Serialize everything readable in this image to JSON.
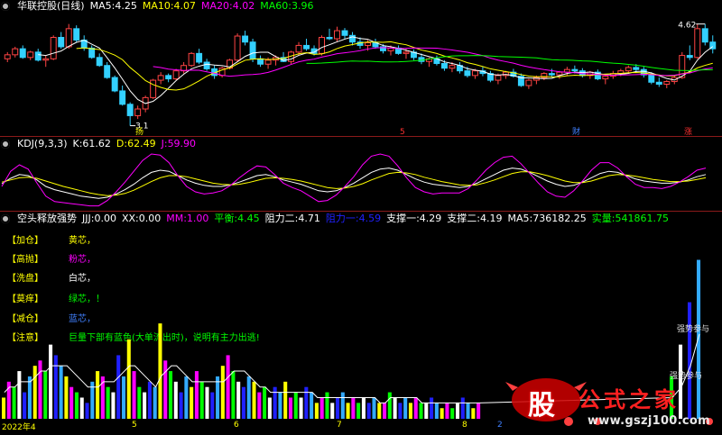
{
  "main_panel": {
    "title": "华联控股(日线)",
    "indicators": [
      {
        "label": "MA5:",
        "value": "4.25",
        "color": "#ffffff"
      },
      {
        "label": "MA10:",
        "value": "4.07",
        "color": "#ffff00"
      },
      {
        "label": "MA20:",
        "value": "4.02",
        "color": "#ff00ff"
      },
      {
        "label": "MA60:",
        "value": "3.96",
        "color": "#00ff00"
      }
    ],
    "high_mark": "4.62",
    "low_mark": "3.1",
    "event_tags": [
      "扬",
      "5",
      "财",
      "涨"
    ]
  },
  "kdj_panel": {
    "title": "KDJ(9,3,3)",
    "indicators": [
      {
        "label": "K:",
        "value": "61.62",
        "color": "#ffffff"
      },
      {
        "label": "D:",
        "value": "62.49",
        "color": "#ffff00"
      },
      {
        "label": "J:",
        "value": "59.90",
        "color": "#ff00ff"
      }
    ]
  },
  "volume_panel": {
    "title": "空头释放强势",
    "indicators": [
      {
        "label": "JJJ:",
        "value": "0.00",
        "color": "#ffffff"
      },
      {
        "label": "XX:",
        "value": "0.00",
        "color": "#ffffff"
      },
      {
        "label": "MM:",
        "value": "1.00",
        "color": "#ff00ff"
      },
      {
        "label": "平衡:",
        "value": "4.45",
        "color": "#00ff00"
      },
      {
        "label": "阻力二:",
        "value": "4.71",
        "color": "#ffffff"
      },
      {
        "label": "阻力一:",
        "value": "4.59",
        "color": "#0000ff"
      },
      {
        "label": "支撑一:",
        "value": "4.29",
        "color": "#ffffff"
      },
      {
        "label": "支撑二:",
        "value": "4.19",
        "color": "#ffffff"
      },
      {
        "label": "MA5:",
        "value": "736182.25",
        "color": "#ffffff"
      },
      {
        "label": "实量:",
        "value": "541861.75",
        "color": "#00ff00"
      }
    ],
    "legend": [
      {
        "key": "【加仓】",
        "text": "黄芯，",
        "color": "#ffff00"
      },
      {
        "key": "【高抛】",
        "text": "粉芯，",
        "color": "#ff00ff"
      },
      {
        "key": "【洗盘】",
        "text": "白芯，",
        "color": "#ffffff"
      },
      {
        "key": "【莫痒】",
        "text": "绿芯，！",
        "color": "#00ff00"
      },
      {
        "key": "【减仓】",
        "text": "蓝芯，",
        "color": "#4080ff"
      },
      {
        "key": "【注意】",
        "text": "巨量下部有蓝色(大单流出时)，说明有主力出逃!",
        "color": "#00ff00"
      }
    ],
    "side_labels": [
      "强势参与",
      "强势参与"
    ]
  },
  "x_axis": {
    "labels": [
      {
        "text": "2022年4",
        "color": "#ffff00"
      },
      {
        "text": "5",
        "color": "#ffff00"
      },
      {
        "text": "6",
        "color": "#ffff00"
      },
      {
        "text": "7",
        "color": "#ffff00"
      },
      {
        "text": "8",
        "color": "#ffff00"
      },
      {
        "text": "2",
        "color": "#4080ff"
      }
    ]
  },
  "watermark": {
    "logo_char": "股",
    "brand": "公式之家",
    "url": "www.gszj100.com"
  },
  "chart_data": [
    {
      "type": "candlestick",
      "title": "华联控股(日线)",
      "ylim": [
        3.0,
        4.75
      ],
      "candles": [
        [
          4.1,
          4.2,
          4.05,
          4.16
        ],
        [
          4.16,
          4.28,
          4.12,
          4.25
        ],
        [
          4.25,
          4.3,
          4.1,
          4.12
        ],
        [
          4.12,
          4.22,
          4.08,
          4.2
        ],
        [
          4.2,
          4.25,
          4.06,
          4.08
        ],
        [
          4.08,
          4.15,
          3.98,
          4.1
        ],
        [
          4.1,
          4.45,
          4.08,
          4.42
        ],
        [
          4.42,
          4.5,
          4.25,
          4.28
        ],
        [
          4.28,
          4.62,
          4.25,
          4.55
        ],
        [
          4.55,
          4.6,
          4.35,
          4.38
        ],
        [
          4.38,
          4.45,
          4.22,
          4.26
        ],
        [
          4.26,
          4.3,
          4.1,
          4.12
        ],
        [
          4.12,
          4.18,
          3.98,
          4.0
        ],
        [
          4.0,
          4.05,
          3.8,
          3.82
        ],
        [
          3.82,
          3.85,
          3.6,
          3.62
        ],
        [
          3.62,
          3.7,
          3.4,
          3.42
        ],
        [
          3.42,
          3.45,
          3.1,
          3.25
        ],
        [
          3.25,
          3.4,
          3.2,
          3.35
        ],
        [
          3.35,
          3.55,
          3.3,
          3.52
        ],
        [
          3.52,
          3.8,
          3.5,
          3.78
        ],
        [
          3.78,
          3.9,
          3.72,
          3.85
        ],
        [
          3.85,
          3.88,
          3.75,
          3.8
        ],
        [
          3.8,
          3.95,
          3.78,
          3.92
        ],
        [
          3.92,
          4.05,
          3.88,
          4.0
        ],
        [
          4.0,
          4.2,
          3.98,
          4.18
        ],
        [
          4.18,
          4.25,
          4.02,
          4.05
        ],
        [
          4.05,
          4.1,
          3.92,
          3.95
        ],
        [
          3.95,
          4.0,
          3.8,
          3.85
        ],
        [
          3.85,
          3.98,
          3.82,
          3.96
        ],
        [
          3.96,
          4.1,
          3.94,
          4.08
        ],
        [
          4.08,
          4.48,
          4.05,
          4.44
        ],
        [
          4.44,
          4.52,
          4.3,
          4.35
        ],
        [
          4.35,
          4.4,
          4.05,
          4.1
        ],
        [
          4.1,
          4.15,
          3.98,
          4.02
        ],
        [
          4.02,
          4.12,
          3.95,
          4.08
        ],
        [
          4.08,
          4.15,
          4.0,
          4.12
        ],
        [
          4.12,
          4.2,
          4.05,
          4.06
        ],
        [
          4.06,
          4.22,
          4.02,
          4.2
        ],
        [
          4.2,
          4.35,
          4.15,
          4.3
        ],
        [
          4.3,
          4.4,
          4.22,
          4.25
        ],
        [
          4.25,
          4.3,
          4.15,
          4.18
        ],
        [
          4.18,
          4.45,
          4.15,
          4.42
        ],
        [
          4.42,
          4.55,
          4.38,
          4.4
        ],
        [
          4.4,
          4.58,
          4.35,
          4.52
        ],
        [
          4.52,
          4.56,
          4.4,
          4.45
        ],
        [
          4.45,
          4.5,
          4.3,
          4.35
        ],
        [
          4.35,
          4.42,
          4.25,
          4.3
        ],
        [
          4.3,
          4.38,
          4.22,
          4.34
        ],
        [
          4.34,
          4.4,
          4.25,
          4.28
        ],
        [
          4.28,
          4.32,
          4.18,
          4.22
        ],
        [
          4.22,
          4.3,
          4.15,
          4.26
        ],
        [
          4.26,
          4.3,
          4.16,
          4.18
        ],
        [
          4.18,
          4.25,
          4.1,
          4.2
        ],
        [
          4.2,
          4.24,
          4.08,
          4.12
        ],
        [
          4.12,
          4.18,
          4.02,
          4.06
        ],
        [
          4.06,
          4.12,
          3.98,
          4.1
        ],
        [
          4.1,
          4.15,
          4.0,
          4.03
        ],
        [
          4.03,
          4.08,
          3.92,
          3.96
        ],
        [
          3.96,
          4.05,
          3.9,
          4.0
        ],
        [
          4.0,
          4.05,
          3.88,
          3.92
        ],
        [
          3.92,
          3.98,
          3.82,
          3.85
        ],
        [
          3.85,
          3.95,
          3.8,
          3.92
        ],
        [
          3.92,
          3.98,
          3.84,
          3.88
        ],
        [
          3.88,
          3.92,
          3.75,
          3.78
        ],
        [
          3.78,
          3.88,
          3.72,
          3.85
        ],
        [
          3.85,
          3.92,
          3.8,
          3.9
        ],
        [
          3.9,
          3.95,
          3.82,
          3.84
        ],
        [
          3.84,
          3.88,
          3.68,
          3.7
        ],
        [
          3.7,
          3.8,
          3.65,
          3.78
        ],
        [
          3.78,
          3.85,
          3.72,
          3.82
        ],
        [
          3.82,
          3.9,
          3.78,
          3.88
        ],
        [
          3.88,
          3.95,
          3.82,
          3.86
        ],
        [
          3.86,
          3.92,
          3.8,
          3.9
        ],
        [
          3.9,
          3.98,
          3.85,
          3.94
        ],
        [
          3.94,
          4.0,
          3.88,
          3.92
        ],
        [
          3.92,
          3.96,
          3.82,
          3.85
        ],
        [
          3.85,
          3.92,
          3.8,
          3.9
        ],
        [
          3.9,
          3.94,
          3.78,
          3.8
        ],
        [
          3.8,
          3.86,
          3.72,
          3.84
        ],
        [
          3.84,
          3.92,
          3.8,
          3.88
        ],
        [
          3.88,
          3.95,
          3.84,
          3.92
        ],
        [
          3.92,
          4.0,
          3.88,
          3.97
        ],
        [
          3.97,
          4.02,
          3.9,
          3.94
        ],
        [
          3.94,
          3.98,
          3.82,
          3.86
        ],
        [
          3.86,
          3.9,
          3.72,
          3.75
        ],
        [
          3.75,
          3.82,
          3.68,
          3.72
        ],
        [
          3.72,
          3.78,
          3.66,
          3.76
        ],
        [
          3.76,
          3.85,
          3.72,
          3.82
        ],
        [
          3.82,
          4.2,
          3.8,
          4.15
        ],
        [
          4.15,
          4.3,
          4.08,
          4.12
        ],
        [
          4.12,
          4.62,
          4.1,
          4.55
        ],
        [
          4.55,
          4.62,
          4.3,
          4.35
        ],
        [
          4.35,
          4.45,
          4.18,
          4.25
        ]
      ]
    },
    {
      "type": "line",
      "title": "KDJ(9,3,3)",
      "ylim": [
        0,
        100
      ],
      "series": [
        {
          "name": "K",
          "values": [
            45,
            55,
            62,
            60,
            52,
            40,
            34,
            30,
            26,
            22,
            20,
            18,
            20,
            26,
            34,
            44,
            56,
            66,
            70,
            68,
            60,
            52,
            46,
            42,
            40,
            40,
            43,
            48,
            54,
            60,
            62,
            58,
            52,
            48,
            44,
            38,
            32,
            30,
            32,
            38,
            46,
            56,
            66,
            72,
            74,
            70,
            62,
            54,
            48,
            44,
            42,
            40,
            38,
            40,
            46,
            54,
            62,
            70,
            74,
            72,
            66,
            58,
            50,
            44,
            40,
            42,
            48,
            56,
            64,
            68,
            66,
            60,
            54,
            50,
            48,
            46,
            46,
            48,
            52,
            58,
            62
          ]
        },
        {
          "name": "D",
          "values": [
            48,
            52,
            56,
            57,
            55,
            50,
            45,
            40,
            36,
            32,
            28,
            25,
            23,
            24,
            27,
            33,
            41,
            49,
            56,
            60,
            60,
            58,
            54,
            50,
            46,
            44,
            43,
            44,
            47,
            51,
            55,
            56,
            55,
            53,
            50,
            46,
            42,
            38,
            36,
            37,
            40,
            45,
            52,
            58,
            64,
            66,
            65,
            62,
            57,
            53,
            49,
            46,
            43,
            42,
            43,
            47,
            52,
            58,
            64,
            67,
            67,
            64,
            60,
            55,
            50,
            47,
            47,
            50,
            55,
            60,
            62,
            61,
            59,
            56,
            53,
            51,
            49,
            49,
            50,
            53,
            56
          ]
        },
        {
          "name": "J",
          "values": [
            40,
            68,
            80,
            72,
            46,
            22,
            12,
            10,
            8,
            6,
            4,
            4,
            14,
            30,
            48,
            68,
            88,
            100,
            98,
            84,
            60,
            40,
            30,
            26,
            28,
            32,
            42,
            56,
            68,
            78,
            76,
            62,
            46,
            38,
            32,
            22,
            12,
            14,
            24,
            40,
            58,
            80,
            96,
            100,
            96,
            78,
            56,
            38,
            30,
            26,
            28,
            28,
            28,
            36,
            52,
            70,
            84,
            94,
            96,
            82,
            64,
            46,
            30,
            22,
            20,
            32,
            50,
            70,
            84,
            84,
            74,
            58,
            44,
            38,
            38,
            36,
            40,
            48,
            58,
            70,
            74
          ]
        }
      ]
    },
    {
      "type": "bar",
      "title": "空头释放强势",
      "series": [
        {
          "name": "实量",
          "values": [
            4,
            7,
            6,
            9,
            5,
            8,
            10,
            11,
            9,
            14,
            12,
            10,
            8,
            6,
            5,
            4,
            3,
            7,
            9,
            8,
            6,
            5,
            12,
            8,
            15,
            9,
            6,
            5,
            7,
            6,
            18,
            11,
            9,
            7,
            5,
            8,
            6,
            9,
            7,
            6,
            5,
            8,
            10,
            12,
            9,
            7,
            6,
            8,
            7,
            5,
            6,
            4,
            6,
            5,
            7,
            4,
            5,
            4,
            6,
            5,
            3,
            4,
            5,
            3,
            4,
            5,
            3,
            4,
            3,
            4,
            3,
            4,
            3,
            3,
            5,
            4,
            3,
            4,
            3,
            4,
            3,
            3,
            4,
            3,
            2,
            3,
            2,
            3,
            4,
            3,
            2,
            3,
            8,
            14,
            22,
            30
          ]
        },
        {
          "name": "MA5",
          "values": [
            5,
            6,
            6,
            7,
            7,
            7,
            8,
            9,
            9,
            10,
            10,
            10,
            10,
            9,
            8,
            7,
            6,
            6,
            6,
            7,
            7,
            7,
            8,
            9,
            10,
            10,
            9,
            8,
            7,
            6,
            8,
            9,
            10,
            10,
            9,
            8,
            7,
            7,
            7,
            7,
            7,
            7,
            7,
            8,
            9,
            9,
            9,
            8,
            7,
            6,
            6,
            5,
            5,
            5,
            5,
            5,
            5,
            5,
            5,
            5,
            4,
            4,
            4,
            4,
            4,
            4,
            4,
            4,
            4,
            4,
            4,
            4,
            3,
            3,
            4,
            4,
            4,
            4,
            4,
            4,
            3,
            3,
            3,
            3,
            3,
            3,
            3,
            3,
            3,
            3,
            3,
            3,
            4,
            6,
            10,
            16
          ]
        }
      ]
    }
  ]
}
